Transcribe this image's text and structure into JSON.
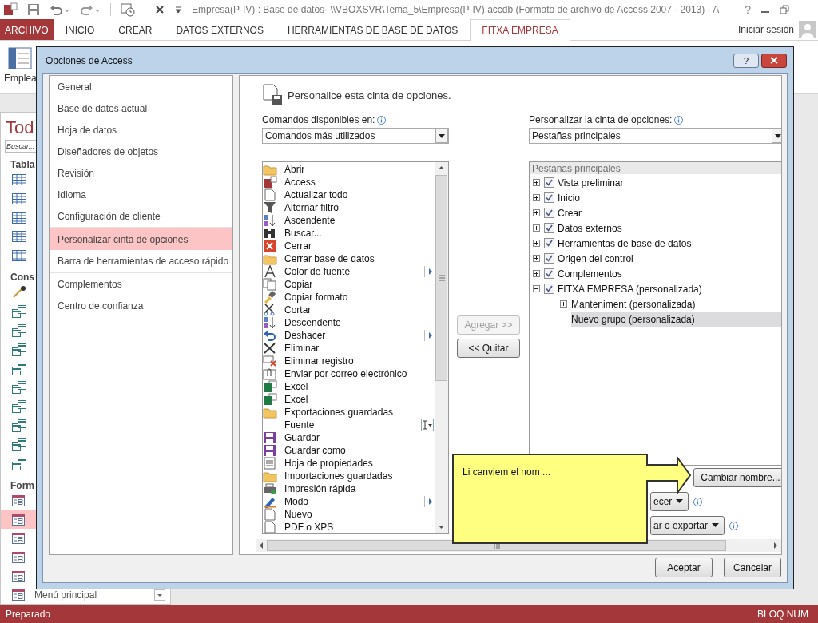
{
  "app": {
    "title": "Empresa(P-IV) : Base de datos- \\\\VBOXSVR\\Tema_5\\Empresa(P-IV).accdb (Formato de archivo de Access 2007 - 2013) - A",
    "window_help": "?",
    "ribbon_tabs": [
      {
        "label": "ARCHIVO",
        "kind": "file",
        "selected": false
      },
      {
        "label": "INICIO",
        "kind": "tab",
        "selected": false
      },
      {
        "label": "CREAR",
        "kind": "tab",
        "selected": false
      },
      {
        "label": "DATOS EXTERNOS",
        "kind": "tab",
        "selected": false
      },
      {
        "label": "HERRAMIENTAS DE BASE DE DATOS",
        "kind": "tab",
        "selected": false
      },
      {
        "label": "FITXA EMPRESA",
        "kind": "tab",
        "selected": true
      }
    ],
    "account": "Iniciar sesión",
    "ribbon_command": "Emplea",
    "nav": {
      "title": "Tod",
      "search_placeholder": "Buscar...",
      "groups": [
        {
          "label": "Tabla",
          "items": [
            {
              "kind": "table",
              "selected": false
            },
            {
              "kind": "table",
              "selected": false
            },
            {
              "kind": "table",
              "selected": false
            },
            {
              "kind": "table",
              "selected": false
            },
            {
              "kind": "table",
              "selected": false
            }
          ]
        },
        {
          "label": "Cons",
          "items": [
            {
              "kind": "design",
              "selected": false
            },
            {
              "kind": "query",
              "selected": false
            },
            {
              "kind": "query",
              "selected": false
            },
            {
              "kind": "query",
              "selected": false
            },
            {
              "kind": "query",
              "selected": false
            },
            {
              "kind": "query",
              "selected": false
            },
            {
              "kind": "query",
              "selected": false
            },
            {
              "kind": "query",
              "selected": false
            },
            {
              "kind": "query",
              "selected": false
            },
            {
              "kind": "query",
              "selected": false
            }
          ]
        },
        {
          "label": "Form",
          "items": [
            {
              "kind": "form",
              "selected": false
            },
            {
              "kind": "form",
              "selected": true
            },
            {
              "kind": "form",
              "selected": false
            },
            {
              "kind": "form",
              "selected": false
            },
            {
              "kind": "form",
              "selected": false
            }
          ]
        }
      ],
      "bottom_item": "Menú principal"
    },
    "status": "Preparado",
    "status_right": "BLOQ NUM"
  },
  "dialog": {
    "title": "Opciones de Access",
    "help": "?",
    "categories": [
      {
        "label": "General",
        "selected": false,
        "divider_before": false
      },
      {
        "label": "Base de datos actual",
        "selected": false,
        "divider_before": false
      },
      {
        "label": "Hoja de datos",
        "selected": false,
        "divider_before": false
      },
      {
        "label": "Diseñadores de objetos",
        "selected": false,
        "divider_before": false
      },
      {
        "label": "Revisión",
        "selected": false,
        "divider_before": false
      },
      {
        "label": "Idioma",
        "selected": false,
        "divider_before": false
      },
      {
        "label": "Configuración de cliente",
        "selected": false,
        "divider_before": false
      },
      {
        "label": "Personalizar cinta de opciones",
        "selected": true,
        "divider_before": true
      },
      {
        "label": "Barra de herramientas de acceso rápido",
        "selected": false,
        "divider_before": false
      },
      {
        "label": "Complementos",
        "selected": false,
        "divider_before": true
      },
      {
        "label": "Centro de confianza",
        "selected": false,
        "divider_before": false
      }
    ],
    "heading": "Personalice esta cinta de opciones.",
    "commands_label": "Comandos disponibles en:",
    "commands_source": "Comandos más utilizados",
    "commands": [
      {
        "label": "Abrir",
        "kind": "plain"
      },
      {
        "label": "Access",
        "kind": "plain"
      },
      {
        "label": "Actualizar todo",
        "kind": "plain"
      },
      {
        "label": "Alternar filtro",
        "kind": "plain"
      },
      {
        "label": "Ascendente",
        "kind": "plain"
      },
      {
        "label": "Buscar...",
        "kind": "plain"
      },
      {
        "label": "Cerrar",
        "kind": "plain"
      },
      {
        "label": "Cerrar base de datos",
        "kind": "plain"
      },
      {
        "label": "Color de fuente",
        "kind": "submenu"
      },
      {
        "label": "Copiar",
        "kind": "plain"
      },
      {
        "label": "Copiar formato",
        "kind": "plain"
      },
      {
        "label": "Cortar",
        "kind": "plain"
      },
      {
        "label": "Descendente",
        "kind": "plain"
      },
      {
        "label": "Deshacer",
        "kind": "submenu"
      },
      {
        "label": "Eliminar",
        "kind": "plain"
      },
      {
        "label": "Eliminar registro",
        "kind": "plain"
      },
      {
        "label": "Enviar por correo electrónico",
        "kind": "plain"
      },
      {
        "label": "Excel",
        "kind": "plain"
      },
      {
        "label": "Excel",
        "kind": "plain"
      },
      {
        "label": "Exportaciones guardadas",
        "kind": "plain"
      },
      {
        "label": "Fuente",
        "kind": "font"
      },
      {
        "label": "Guardar",
        "kind": "plain"
      },
      {
        "label": "Guardar como",
        "kind": "plain"
      },
      {
        "label": "Hoja de propiedades",
        "kind": "plain"
      },
      {
        "label": "Importaciones guardadas",
        "kind": "plain"
      },
      {
        "label": "Impresión rápida",
        "kind": "plain"
      },
      {
        "label": "Modo",
        "kind": "submenu"
      },
      {
        "label": "Nuevo",
        "kind": "plain"
      },
      {
        "label": "PDF o XPS",
        "kind": "plain"
      }
    ],
    "add_button": {
      "label": "Agregar >>",
      "disabled": true
    },
    "remove_button": {
      "label": "<< Quitar",
      "disabled": false
    },
    "ribbon_label": "Personalizar la cinta de opciones:",
    "ribbon_source": "Pestañas principales",
    "tree_header": "Pestañas principales",
    "tree": [
      {
        "label": "Vista preliminar",
        "kind": "tab",
        "checked": true,
        "expanded": false,
        "selected": false
      },
      {
        "label": "Inicio",
        "kind": "tab",
        "checked": true,
        "expanded": false,
        "selected": false
      },
      {
        "label": "Crear",
        "kind": "tab",
        "checked": true,
        "expanded": false,
        "selected": false
      },
      {
        "label": "Datos externos",
        "kind": "tab",
        "checked": true,
        "expanded": false,
        "selected": false
      },
      {
        "label": "Herramientas de base de datos",
        "kind": "tab",
        "checked": true,
        "expanded": false,
        "selected": false
      },
      {
        "label": "Origen del control",
        "kind": "tab",
        "checked": true,
        "expanded": false,
        "selected": false
      },
      {
        "label": "Complementos",
        "kind": "tab",
        "checked": true,
        "expanded": false,
        "selected": false
      },
      {
        "label": "FITXA EMPRESA (personalizada)",
        "kind": "tab",
        "checked": true,
        "expanded": true,
        "selected": false,
        "children": [
          {
            "label": "Manteniment (personalizada)",
            "kind": "group",
            "expanded": false,
            "selected": false
          },
          {
            "label": "Nuevo grupo (personalizada)",
            "kind": "group",
            "selected": true
          }
        ]
      }
    ],
    "rename_button": "Cambiar nombre...",
    "reset_button": "ecer",
    "import_button": "ar o exportar",
    "ok": "Aceptar",
    "cancel": "Cancelar"
  },
  "callout": {
    "text": "Li canviem el nom ..."
  }
}
